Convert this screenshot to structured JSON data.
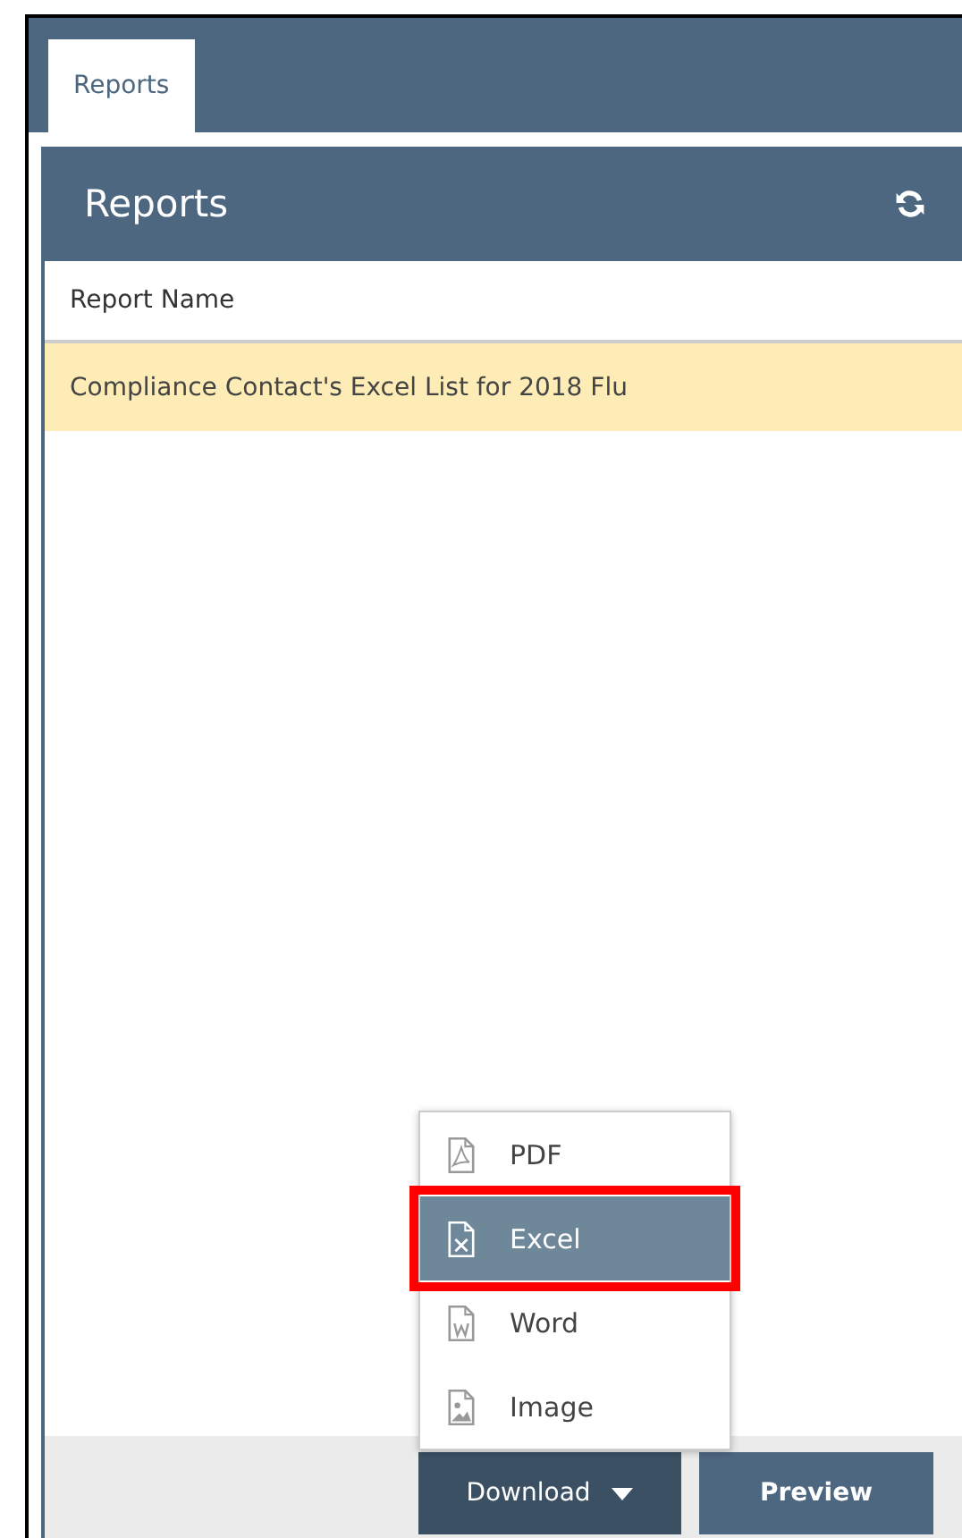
{
  "tabs": [
    {
      "label": "Reports",
      "selected": true
    }
  ],
  "panel": {
    "title": "Reports",
    "table": {
      "columns": [
        "Report Name"
      ],
      "rows": [
        {
          "cells": [
            "Compliance Contact's Excel List for 2018 Flu"
          ],
          "selected": true
        }
      ]
    }
  },
  "download_menu": {
    "expanded": true,
    "items": [
      {
        "kind": "pdf",
        "label": "PDF",
        "selected": false,
        "highlighted": false
      },
      {
        "kind": "excel",
        "label": "Excel",
        "selected": true,
        "highlighted": true
      },
      {
        "kind": "word",
        "label": "Word",
        "selected": false,
        "highlighted": false
      },
      {
        "kind": "image",
        "label": "Image",
        "selected": false,
        "highlighted": false
      }
    ]
  },
  "buttons": [
    {
      "kind": "dropdown",
      "label": "Download"
    },
    {
      "kind": "plain",
      "label": "Preview"
    }
  ]
}
